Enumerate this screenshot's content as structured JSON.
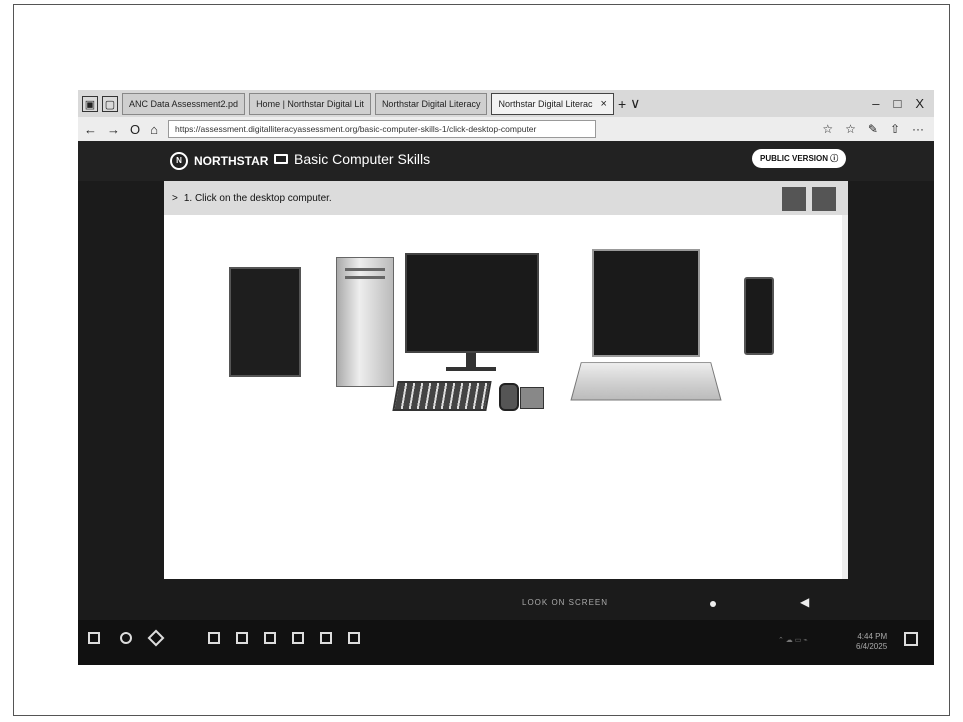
{
  "browser": {
    "tabs": [
      {
        "label": "ANC Data Assessment2.pd"
      },
      {
        "label": "Home | Northstar Digital Lit"
      },
      {
        "label": "Northstar Digital Literacy"
      },
      {
        "label": "Northstar Digital Literac"
      }
    ],
    "new_tab": "+",
    "tab_dropdown": "∨",
    "window_controls": {
      "min": "–",
      "max": "□",
      "close": "X"
    },
    "nav": {
      "back": "←",
      "forward": "→",
      "refresh": "O",
      "home": "⌂"
    },
    "url": "https://assessment.digitalliteracyassessment.org/basic-computer-skills-1/click-desktop-computer",
    "tools": {
      "favorite": "☆",
      "favorites": "☆",
      "pen": "✎",
      "share": "⇧",
      "more": "···"
    }
  },
  "app": {
    "brand": "NORTHSTAR",
    "section": "Basic Computer Skills",
    "public_version": "PUBLIC VERSION"
  },
  "question": {
    "arrow": ">",
    "text": "1. Click on the desktop computer."
  },
  "footer": {
    "caption": "LOOK ON SCREEN"
  },
  "taskbar": {
    "clock_time": "4:44 PM",
    "clock_date": "6/4/2025"
  }
}
